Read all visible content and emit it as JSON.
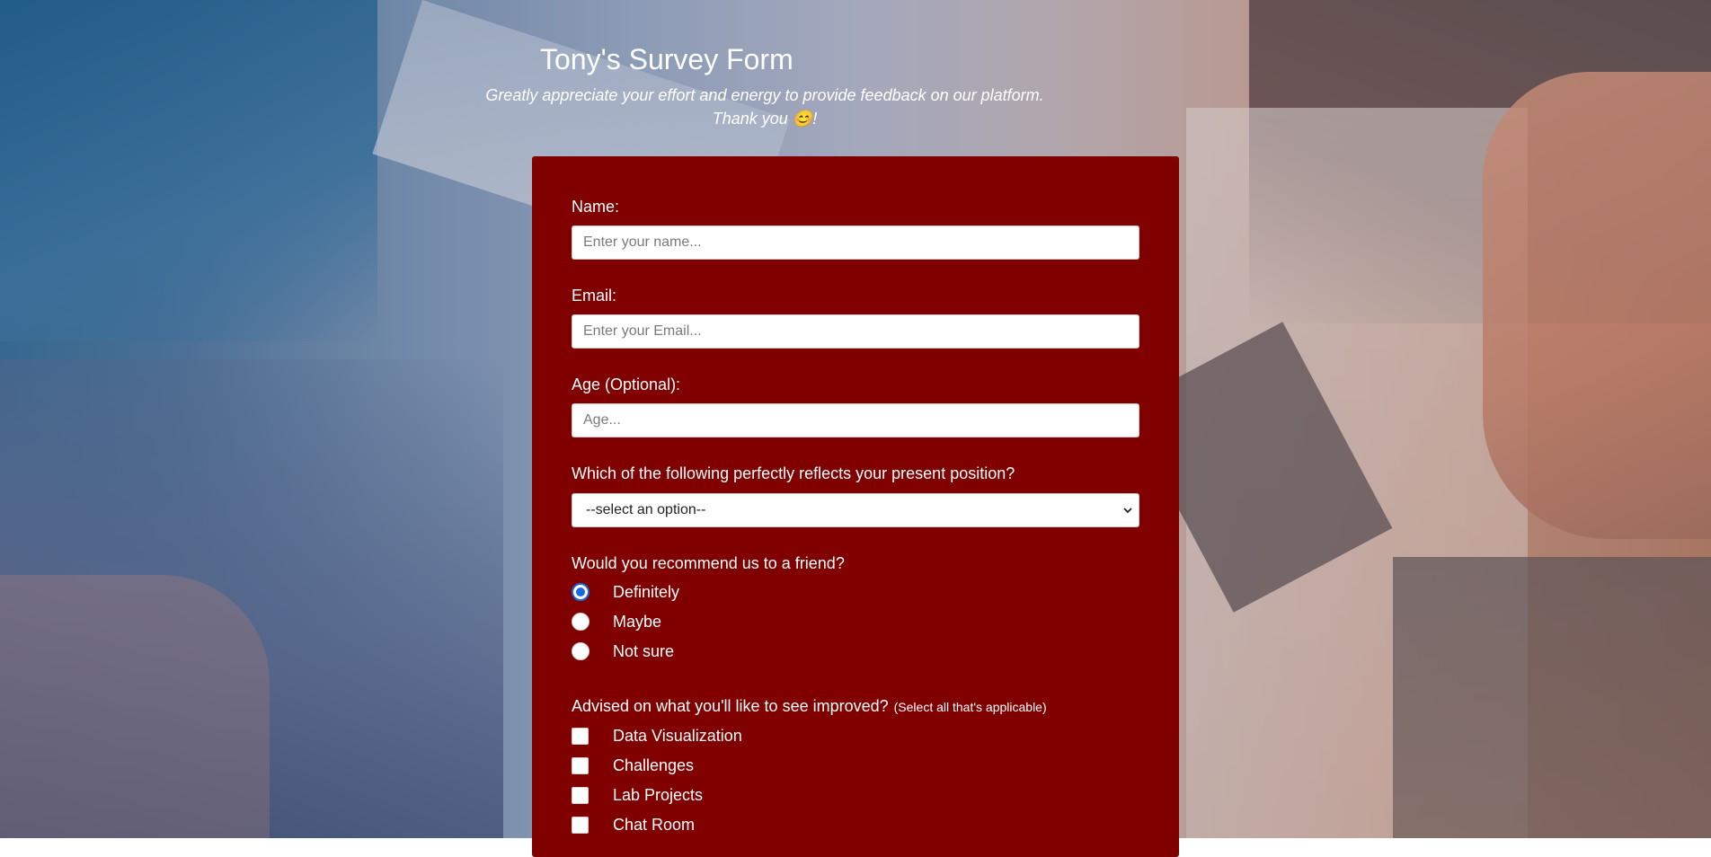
{
  "header": {
    "title": "Tony's Survey Form",
    "description_line1": "Greatly appreciate your effort and energy to provide feedback on our platform.",
    "description_line2": "Thank you 😊!"
  },
  "form": {
    "name": {
      "label": "Name:",
      "placeholder": "Enter your name...",
      "value": ""
    },
    "email": {
      "label": "Email:",
      "placeholder": "Enter your Email...",
      "value": ""
    },
    "age": {
      "label": "Age (Optional):",
      "placeholder": "Age...",
      "value": ""
    },
    "position": {
      "label": "Which of the following perfectly reflects your present position?",
      "selected": "--select an option--"
    },
    "recommend": {
      "label": "Would you recommend us to a friend?",
      "options": [
        {
          "label": "Definitely",
          "checked": true
        },
        {
          "label": "Maybe",
          "checked": false
        },
        {
          "label": "Not sure",
          "checked": false
        }
      ]
    },
    "improve": {
      "label": "Advised on what you'll like to see improved?",
      "hint": "(Select all that's applicable)",
      "options": [
        {
          "label": "Data Visualization",
          "checked": false
        },
        {
          "label": "Challenges",
          "checked": false
        },
        {
          "label": "Lab Projects",
          "checked": false
        },
        {
          "label": "Chat Room",
          "checked": false
        }
      ]
    }
  },
  "colors": {
    "form_background": "#800000",
    "radio_accent": "#1769e0",
    "text": "#ffffff"
  }
}
